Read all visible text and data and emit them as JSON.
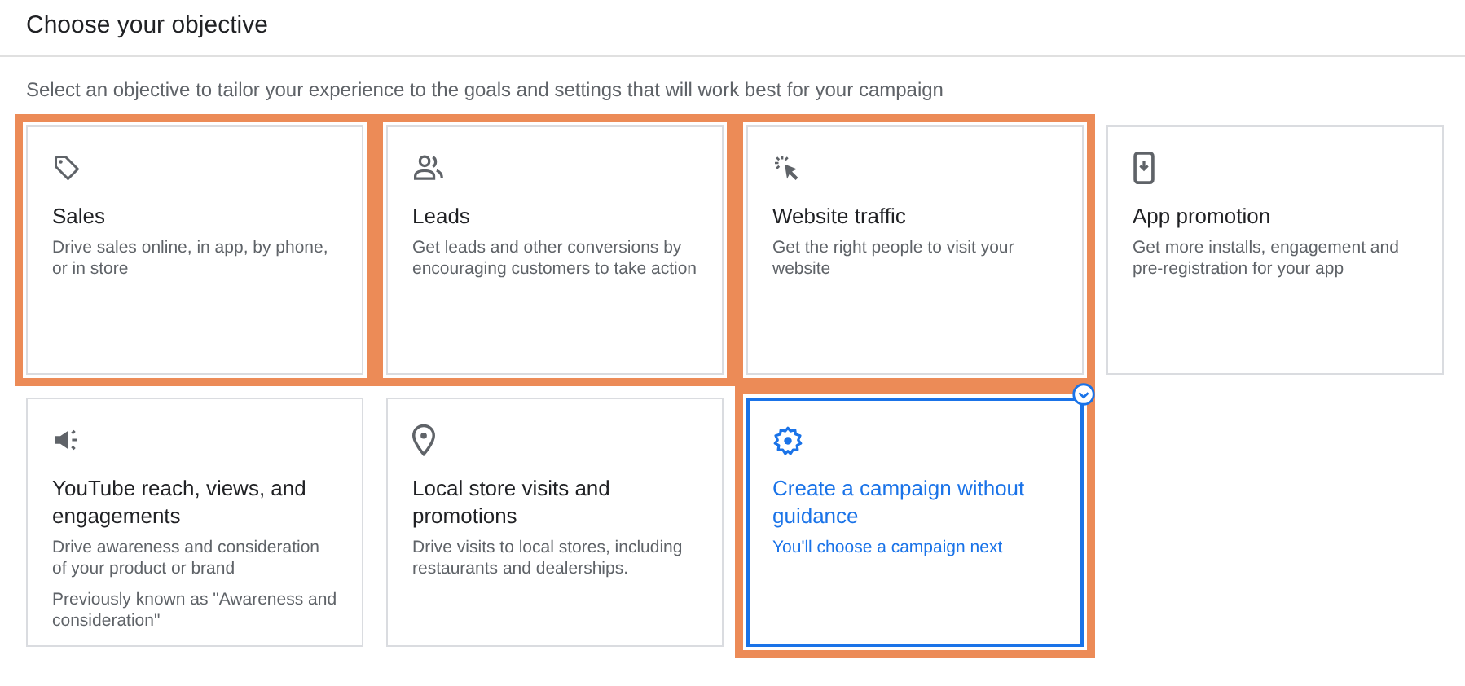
{
  "header": {
    "title": "Choose your objective"
  },
  "subtitle": "Select an objective to tailor your experience to the goals and settings that will work best for your campaign",
  "objectives": [
    {
      "kind": "tag",
      "title": "Sales",
      "descriptions": [
        "Drive sales online, in app, by phone, or in store"
      ],
      "highlighted": true,
      "selected": false
    },
    {
      "kind": "people",
      "title": "Leads",
      "descriptions": [
        "Get leads and other conversions by encouraging customers to take action"
      ],
      "highlighted": true,
      "selected": false
    },
    {
      "kind": "cursor",
      "title": "Website traffic",
      "descriptions": [
        "Get the right people to visit your website"
      ],
      "highlighted": true,
      "selected": false
    },
    {
      "kind": "phone",
      "title": "App promotion",
      "descriptions": [
        "Get more installs, engagement and pre-registration for your app"
      ],
      "highlighted": false,
      "selected": false
    },
    {
      "kind": "speaker",
      "title": "YouTube reach, views, and engagements",
      "descriptions": [
        "Drive awareness and consideration of your product or brand",
        "Previously known as \"Awareness and consideration\""
      ],
      "highlighted": false,
      "selected": false
    },
    {
      "kind": "pin",
      "title": "Local store visits and promotions",
      "descriptions": [
        "Drive visits to local stores, including restaurants and dealerships."
      ],
      "highlighted": false,
      "selected": false
    },
    {
      "kind": "gear",
      "title": "Create a campaign without guidance",
      "descriptions": [
        "You'll choose a campaign next"
      ],
      "highlighted": true,
      "selected": true
    }
  ]
}
